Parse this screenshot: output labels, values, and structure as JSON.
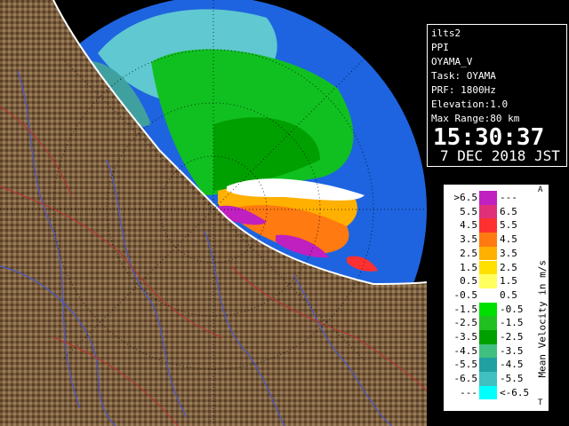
{
  "info": {
    "site": "ilts2",
    "product": "PPI",
    "name": "OYAMA_V",
    "task": "Task: OYAMA",
    "prf": "PRF: 1800Hz",
    "elevation": "Elevation:1.0",
    "max_range": "Max Range:80 km",
    "time": "15:30:37",
    "date": "7 DEC 2018 JST"
  },
  "legend": {
    "unit_label": "Mean Velocity in m/s",
    "top_letter": "A",
    "bottom_letter": "T",
    "rows": [
      {
        "lo": ">6.5",
        "hi": "---",
        "color": "#c020c0"
      },
      {
        "lo": "5.5",
        "hi": "6.5",
        "color": "#e0307a"
      },
      {
        "lo": "4.5",
        "hi": "5.5",
        "color": "#ff3030"
      },
      {
        "lo": "3.5",
        "hi": "4.5",
        "color": "#ff7a10"
      },
      {
        "lo": "2.5",
        "hi": "3.5",
        "color": "#ffb000"
      },
      {
        "lo": "1.5",
        "hi": "2.5",
        "color": "#ffe000"
      },
      {
        "lo": "0.5",
        "hi": "1.5",
        "color": "#ffff60"
      },
      {
        "lo": "-0.5",
        "hi": "0.5",
        "color": "#ffffff"
      },
      {
        "lo": "-1.5",
        "hi": "-0.5",
        "color": "#00e000"
      },
      {
        "lo": "-2.5",
        "hi": "-1.5",
        "color": "#20c020"
      },
      {
        "lo": "-3.5",
        "hi": "-2.5",
        "color": "#00a000"
      },
      {
        "lo": "-4.5",
        "hi": "-3.5",
        "color": "#40c080"
      },
      {
        "lo": "-5.5",
        "hi": "-4.5",
        "color": "#20a0a0"
      },
      {
        "lo": "-6.5",
        "hi": "-5.5",
        "color": "#40c0c0"
      },
      {
        "lo": "---",
        "hi": "<-6.5",
        "color": "#00ffff"
      }
    ]
  },
  "map": {
    "range_background": "#1e64e0",
    "land_color": "#7a5a3a",
    "river_color": "#4a58c8",
    "border_color": "#c03030"
  }
}
